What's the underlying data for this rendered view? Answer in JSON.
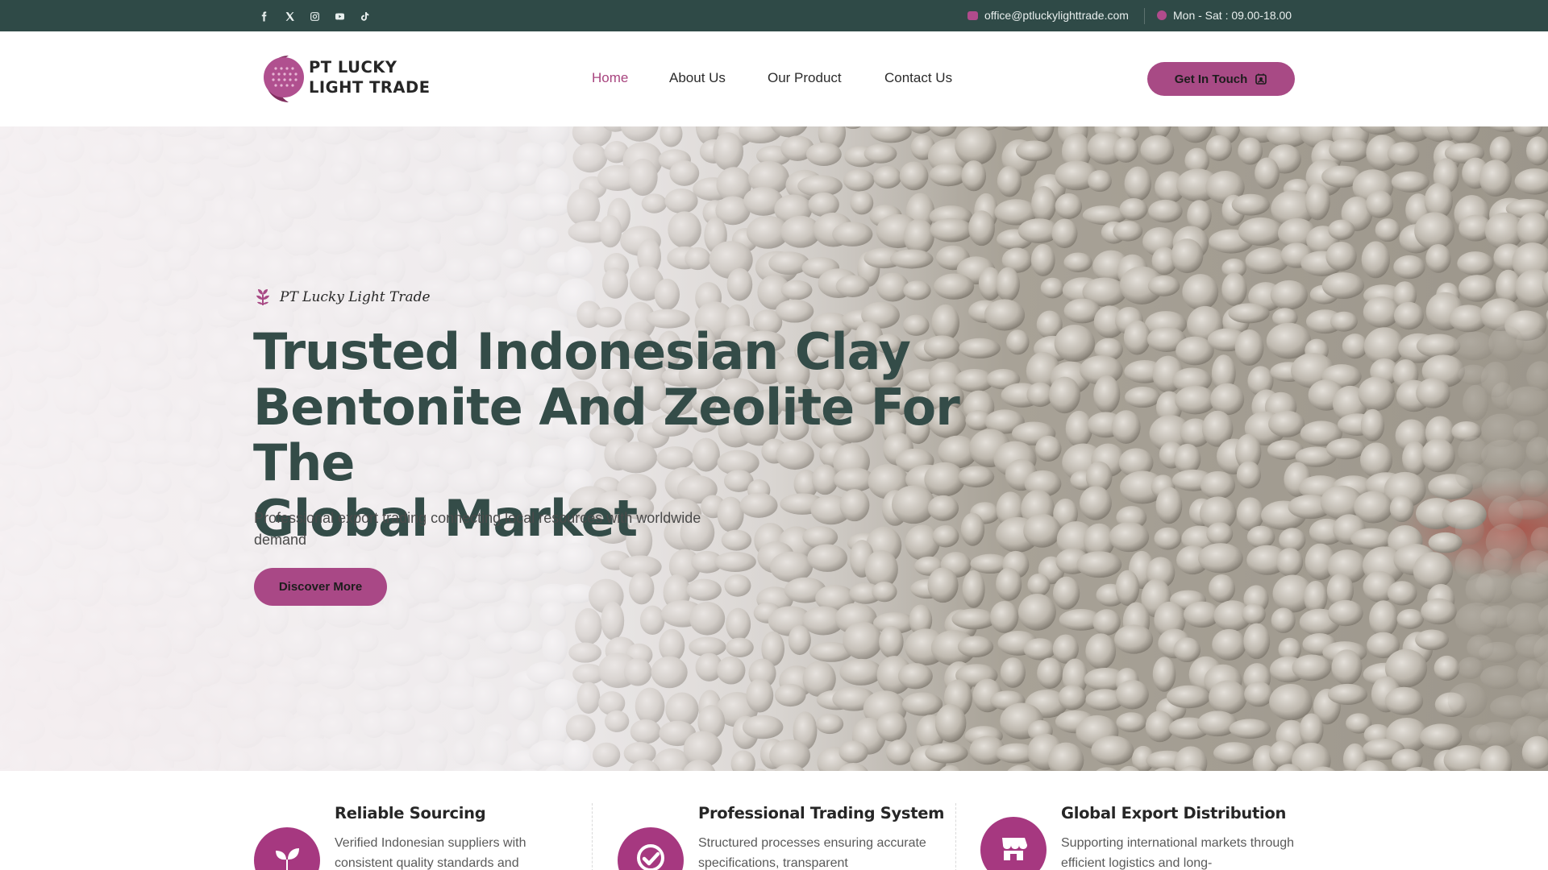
{
  "topbar": {
    "social": [
      "facebook-icon",
      "x-icon",
      "instagram-icon",
      "youtube-icon",
      "tiktok-icon"
    ],
    "email": "office@ptluckylighttrade.com",
    "hours": "Mon - Sat : 09.00-18.00"
  },
  "header": {
    "logo_line1": "PT LUCKY",
    "logo_line2": "LIGHT TRADE",
    "nav": [
      {
        "label": "Home",
        "active": true
      },
      {
        "label": "About Us",
        "active": false
      },
      {
        "label": "Our Product",
        "active": false
      },
      {
        "label": "Contact Us",
        "active": false
      }
    ],
    "cta_label": "Get In Touch"
  },
  "hero": {
    "tagline": "PT Lucky Light Trade",
    "title_line1": "Trusted Indonesian Clay",
    "title_line2": "Bentonite And Zeolite For The",
    "title_line3": "Global Market",
    "subtitle": "Professional export trading connecting local resources with worldwide demand",
    "button_label": "Discover More"
  },
  "features": [
    {
      "title": "Reliable Sourcing",
      "text": "Verified Indonesian suppliers with consistent quality standards and",
      "icon": "sprout-icon"
    },
    {
      "title": "Professional Trading System",
      "text": "Structured processes ensuring accurate specifications, transparent",
      "icon": "check-badge-icon"
    },
    {
      "title": "Global Export Distribution",
      "text": "Supporting international markets through efficient logistics and long-",
      "icon": "storefront-icon"
    }
  ],
  "colors": {
    "topbar": "#2f4a47",
    "accent": "#a84a85",
    "heading": "#344c48"
  }
}
